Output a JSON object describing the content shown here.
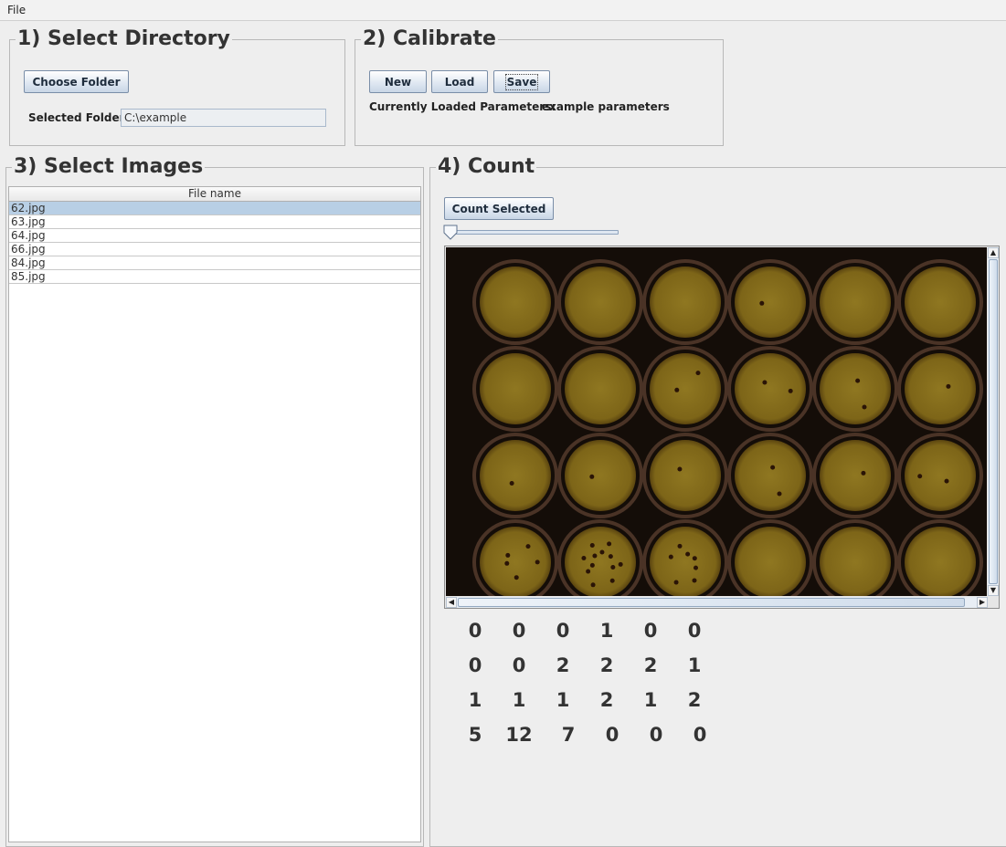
{
  "menu": {
    "file": "File"
  },
  "sections": {
    "select_directory": {
      "title": "1) Select Directory",
      "choose_folder_label": "Choose Folder",
      "selected_folder_label": "Selected Folder:",
      "selected_folder_value": "C:\\example"
    },
    "calibrate": {
      "title": "2) Calibrate",
      "new_label": "New",
      "load_label": "Load",
      "save_label": "Save",
      "loaded_params_label": "Currently Loaded Parameters:",
      "loaded_params_value": "example parameters"
    },
    "select_images": {
      "title": "3) Select Images",
      "column_header": "File name",
      "files": [
        "62.jpg",
        "63.jpg",
        "64.jpg",
        "66.jpg",
        "84.jpg",
        "85.jpg"
      ],
      "selected_index": 0
    },
    "count": {
      "title": "4) Count",
      "count_selected_label": "Count Selected",
      "slider_value": 0,
      "counts": [
        [
          "0",
          "0",
          "0",
          "1",
          "0",
          "0"
        ],
        [
          "0",
          "0",
          "2",
          "2",
          "2",
          "1"
        ],
        [
          "1",
          "1",
          "1",
          "2",
          "1",
          "2"
        ],
        [
          "5",
          "12",
          "7",
          "0",
          "0",
          "0"
        ]
      ]
    }
  },
  "colors": {
    "selection": "#b8cfe5",
    "plate_background": "#140d08",
    "well_fill": "#8a6f1a"
  },
  "icons": {
    "scroll_up": "triangle-up-icon",
    "scroll_down": "triangle-down-icon",
    "scroll_left": "triangle-left-icon",
    "scroll_right": "triangle-right-icon"
  }
}
